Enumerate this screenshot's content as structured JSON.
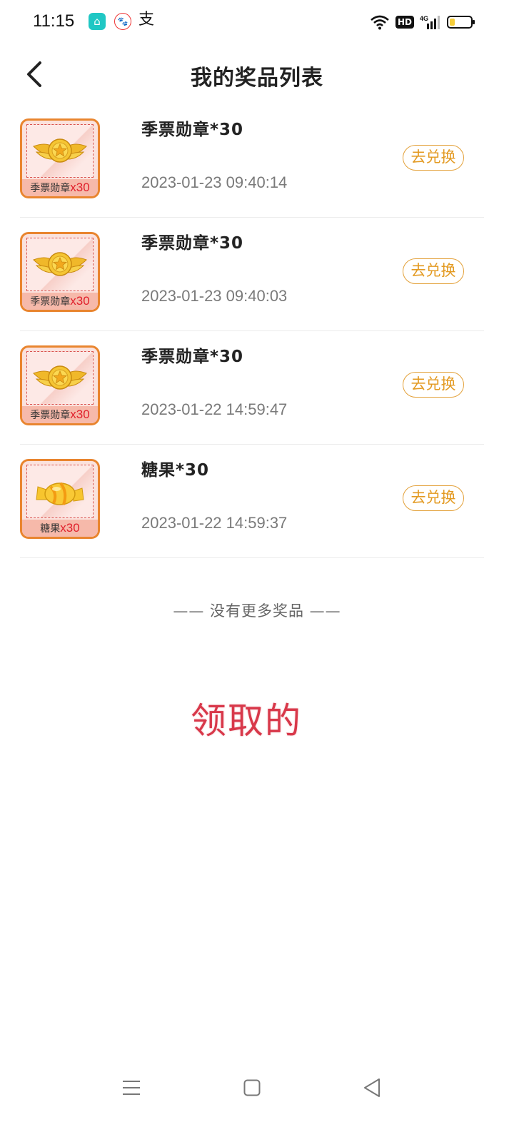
{
  "status_bar": {
    "time": "11:15",
    "app3_glyph": "支",
    "hd_label": "HD",
    "network_label": "4G",
    "icons": [
      "app-home-icon",
      "baidu-app-icon",
      "alipay-icon",
      "wifi-icon",
      "hd-icon",
      "signal-icon",
      "battery-icon"
    ],
    "battery_level": 0.25
  },
  "header": {
    "title": "我的奖品列表",
    "back_icon": "chevron-left-icon"
  },
  "prizes": [
    {
      "name": "季票勋章*30",
      "time": "2023-01-23 09:40:14",
      "thumb_label": "季票勋章",
      "thumb_qty": "x30",
      "button": "去兑换",
      "thumb_icon": "winged-star-badge-icon"
    },
    {
      "name": "季票勋章*30",
      "time": "2023-01-23 09:40:03",
      "thumb_label": "季票勋章",
      "thumb_qty": "x30",
      "button": "去兑换",
      "thumb_icon": "winged-star-badge-icon"
    },
    {
      "name": "季票勋章*30",
      "time": "2023-01-22 14:59:47",
      "thumb_label": "季票勋章",
      "thumb_qty": "x30",
      "button": "去兑换",
      "thumb_icon": "winged-star-badge-icon"
    },
    {
      "name": "糖果*30",
      "time": "2023-01-22 14:59:37",
      "thumb_label": "糖果",
      "thumb_qty": "x30",
      "button": "去兑换",
      "thumb_icon": "candy-icon"
    }
  ],
  "footer_note": "—— 没有更多奖品 ——",
  "overlay_text": "领取的",
  "colors": {
    "accent": "#e39a22",
    "overlay_red": "#d8384a",
    "thumb_border": "#e9852f",
    "qty_red": "#e0202c"
  },
  "nav_bar": {
    "icons": [
      "menu-icon",
      "home-square-icon",
      "back-triangle-icon"
    ]
  }
}
